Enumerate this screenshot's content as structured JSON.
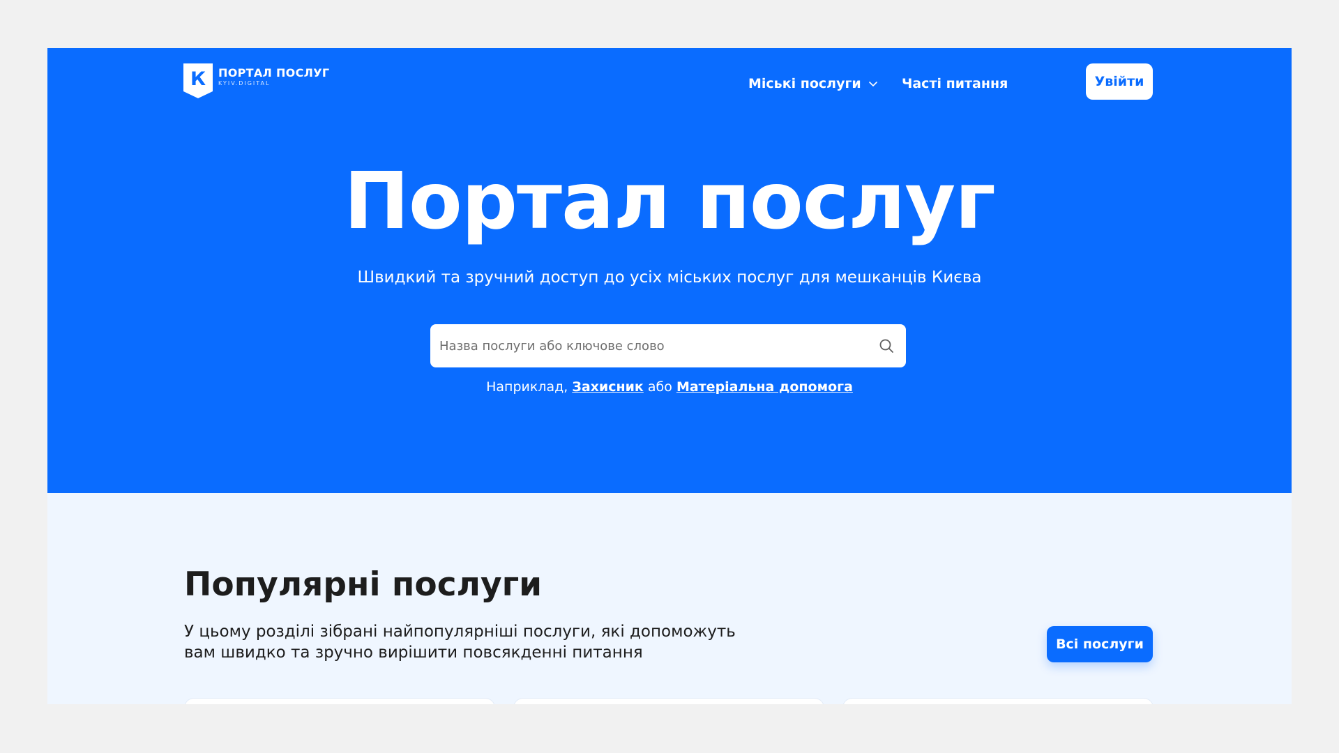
{
  "header": {
    "logo_title": "ПОРТАЛ ПОСЛУГ",
    "logo_subtitle": "KYIV.DIGITAL",
    "logo_letter": "К",
    "nav": {
      "services_label": "Міські послуги",
      "faq_label": "Часті питання"
    },
    "login_label": "Увійти"
  },
  "hero": {
    "title": "Портал послуг",
    "subtitle": "Швидкий та зручний доступ до усіх міських послуг для мешканців Києва",
    "search": {
      "placeholder": "Назва послуги або ключове слово",
      "value": ""
    },
    "hint": {
      "prefix": "Наприклад,",
      "example_1": "Захисник",
      "connector": "або",
      "example_2": "Матеріальна допомога"
    }
  },
  "popular": {
    "title": "Популярні послуги",
    "description_line_1": "У цьому розділі зібрані найпопулярніші послуги, які допоможуть",
    "description_line_2": "вам швидко та зручно вирішити повсякденні питання",
    "all_services_label": "Всі послуги"
  },
  "icons": {
    "logo": "kyiv-digital-shield-icon",
    "nav_dropdown": "chevron-down-icon",
    "search": "search-icon"
  },
  "colors": {
    "brand_blue": "#0a6cff",
    "section_background": "#eff6ff",
    "page_background": "#f1f1f1",
    "text_dark": "#1d1d1d"
  }
}
